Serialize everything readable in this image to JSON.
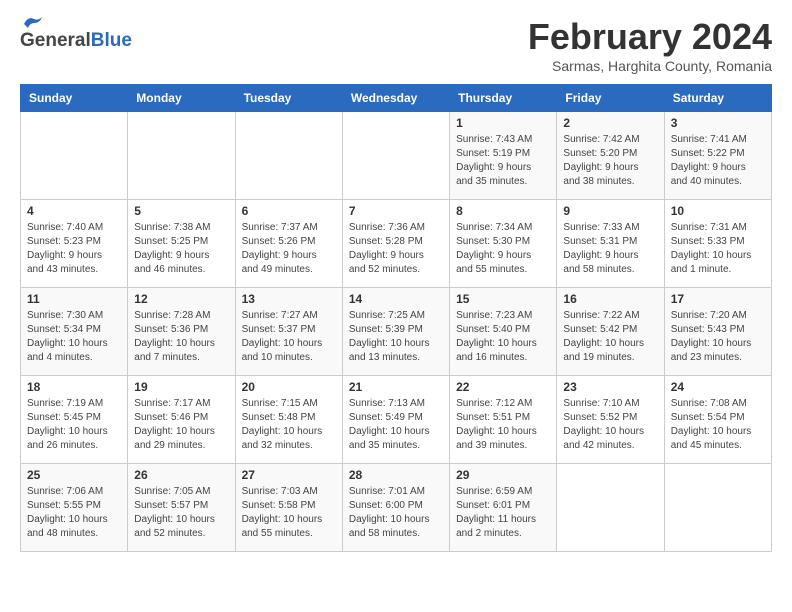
{
  "header": {
    "logo_general": "General",
    "logo_blue": "Blue",
    "month_year": "February 2024",
    "location": "Sarmas, Harghita County, Romania"
  },
  "calendar": {
    "days_of_week": [
      "Sunday",
      "Monday",
      "Tuesday",
      "Wednesday",
      "Thursday",
      "Friday",
      "Saturday"
    ],
    "weeks": [
      [
        {
          "day": "",
          "info": ""
        },
        {
          "day": "",
          "info": ""
        },
        {
          "day": "",
          "info": ""
        },
        {
          "day": "",
          "info": ""
        },
        {
          "day": "1",
          "info": "Sunrise: 7:43 AM\nSunset: 5:19 PM\nDaylight: 9 hours and 35 minutes."
        },
        {
          "day": "2",
          "info": "Sunrise: 7:42 AM\nSunset: 5:20 PM\nDaylight: 9 hours and 38 minutes."
        },
        {
          "day": "3",
          "info": "Sunrise: 7:41 AM\nSunset: 5:22 PM\nDaylight: 9 hours and 40 minutes."
        }
      ],
      [
        {
          "day": "4",
          "info": "Sunrise: 7:40 AM\nSunset: 5:23 PM\nDaylight: 9 hours and 43 minutes."
        },
        {
          "day": "5",
          "info": "Sunrise: 7:38 AM\nSunset: 5:25 PM\nDaylight: 9 hours and 46 minutes."
        },
        {
          "day": "6",
          "info": "Sunrise: 7:37 AM\nSunset: 5:26 PM\nDaylight: 9 hours and 49 minutes."
        },
        {
          "day": "7",
          "info": "Sunrise: 7:36 AM\nSunset: 5:28 PM\nDaylight: 9 hours and 52 minutes."
        },
        {
          "day": "8",
          "info": "Sunrise: 7:34 AM\nSunset: 5:30 PM\nDaylight: 9 hours and 55 minutes."
        },
        {
          "day": "9",
          "info": "Sunrise: 7:33 AM\nSunset: 5:31 PM\nDaylight: 9 hours and 58 minutes."
        },
        {
          "day": "10",
          "info": "Sunrise: 7:31 AM\nSunset: 5:33 PM\nDaylight: 10 hours and 1 minute."
        }
      ],
      [
        {
          "day": "11",
          "info": "Sunrise: 7:30 AM\nSunset: 5:34 PM\nDaylight: 10 hours and 4 minutes."
        },
        {
          "day": "12",
          "info": "Sunrise: 7:28 AM\nSunset: 5:36 PM\nDaylight: 10 hours and 7 minutes."
        },
        {
          "day": "13",
          "info": "Sunrise: 7:27 AM\nSunset: 5:37 PM\nDaylight: 10 hours and 10 minutes."
        },
        {
          "day": "14",
          "info": "Sunrise: 7:25 AM\nSunset: 5:39 PM\nDaylight: 10 hours and 13 minutes."
        },
        {
          "day": "15",
          "info": "Sunrise: 7:23 AM\nSunset: 5:40 PM\nDaylight: 10 hours and 16 minutes."
        },
        {
          "day": "16",
          "info": "Sunrise: 7:22 AM\nSunset: 5:42 PM\nDaylight: 10 hours and 19 minutes."
        },
        {
          "day": "17",
          "info": "Sunrise: 7:20 AM\nSunset: 5:43 PM\nDaylight: 10 hours and 23 minutes."
        }
      ],
      [
        {
          "day": "18",
          "info": "Sunrise: 7:19 AM\nSunset: 5:45 PM\nDaylight: 10 hours and 26 minutes."
        },
        {
          "day": "19",
          "info": "Sunrise: 7:17 AM\nSunset: 5:46 PM\nDaylight: 10 hours and 29 minutes."
        },
        {
          "day": "20",
          "info": "Sunrise: 7:15 AM\nSunset: 5:48 PM\nDaylight: 10 hours and 32 minutes."
        },
        {
          "day": "21",
          "info": "Sunrise: 7:13 AM\nSunset: 5:49 PM\nDaylight: 10 hours and 35 minutes."
        },
        {
          "day": "22",
          "info": "Sunrise: 7:12 AM\nSunset: 5:51 PM\nDaylight: 10 hours and 39 minutes."
        },
        {
          "day": "23",
          "info": "Sunrise: 7:10 AM\nSunset: 5:52 PM\nDaylight: 10 hours and 42 minutes."
        },
        {
          "day": "24",
          "info": "Sunrise: 7:08 AM\nSunset: 5:54 PM\nDaylight: 10 hours and 45 minutes."
        }
      ],
      [
        {
          "day": "25",
          "info": "Sunrise: 7:06 AM\nSunset: 5:55 PM\nDaylight: 10 hours and 48 minutes."
        },
        {
          "day": "26",
          "info": "Sunrise: 7:05 AM\nSunset: 5:57 PM\nDaylight: 10 hours and 52 minutes."
        },
        {
          "day": "27",
          "info": "Sunrise: 7:03 AM\nSunset: 5:58 PM\nDaylight: 10 hours and 55 minutes."
        },
        {
          "day": "28",
          "info": "Sunrise: 7:01 AM\nSunset: 6:00 PM\nDaylight: 10 hours and 58 minutes."
        },
        {
          "day": "29",
          "info": "Sunrise: 6:59 AM\nSunset: 6:01 PM\nDaylight: 11 hours and 2 minutes."
        },
        {
          "day": "",
          "info": ""
        },
        {
          "day": "",
          "info": ""
        }
      ]
    ]
  }
}
